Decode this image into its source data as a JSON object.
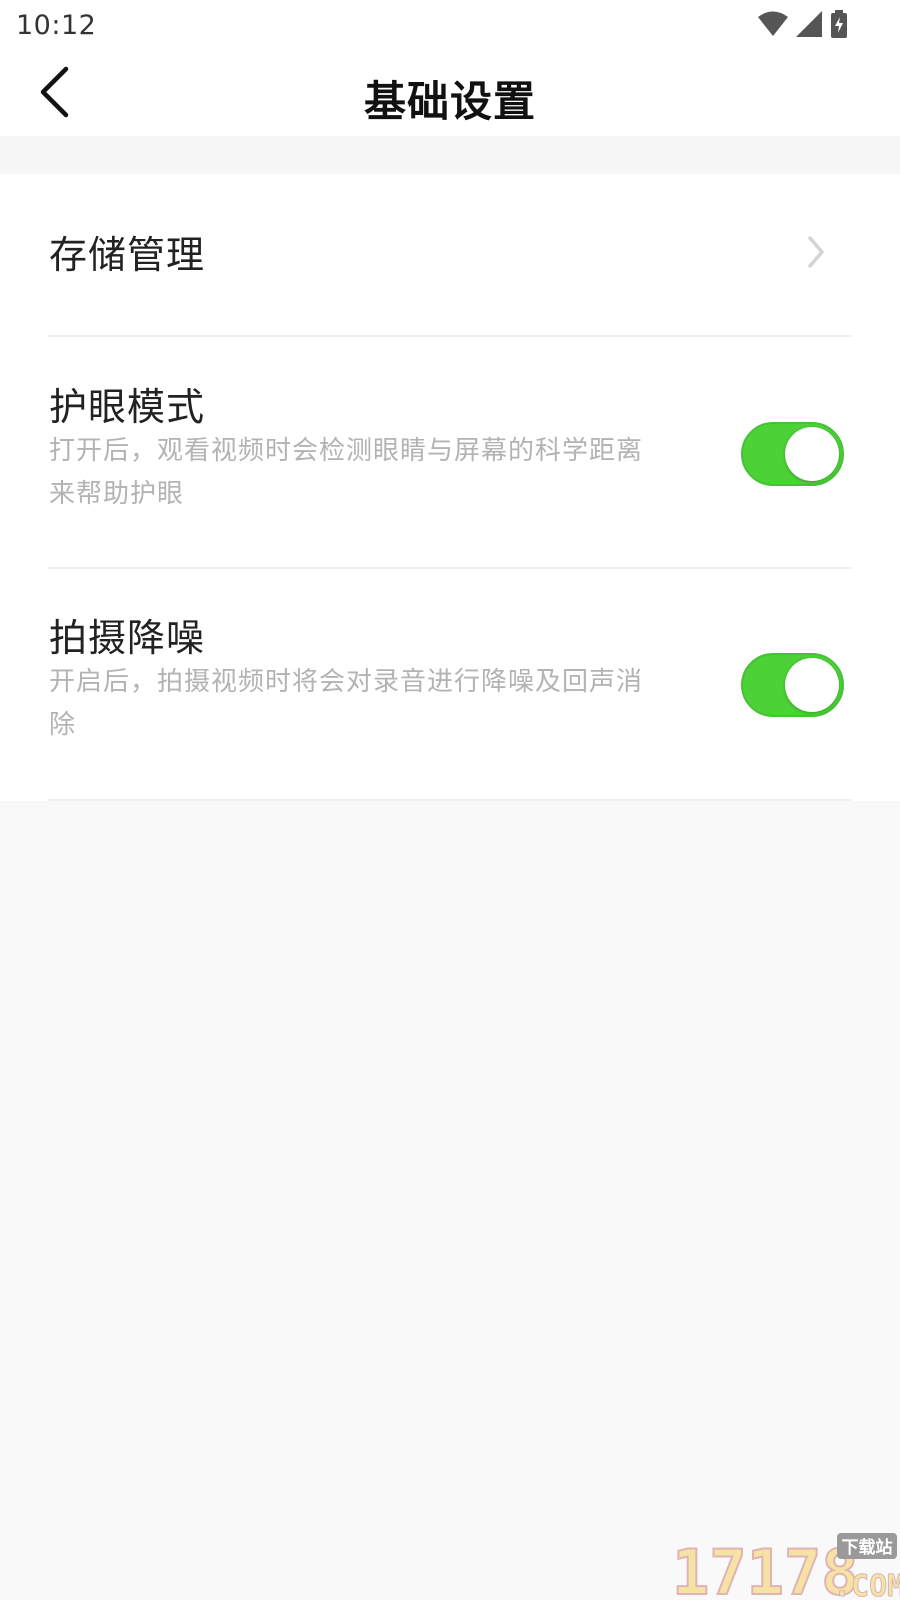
{
  "status_bar": {
    "time": "10:12",
    "icons": [
      "wifi-icon",
      "signal-icon",
      "battery-charging-icon"
    ]
  },
  "nav": {
    "title": "基础设置",
    "back_icon": "chevron-left-icon"
  },
  "settings": {
    "storage": {
      "title": "存储管理",
      "icon": "chevron-right-icon"
    },
    "eye_care": {
      "title": "护眼模式",
      "desc_line1": "打开后，观看视频时会检测眼睛与屏幕的科学距离",
      "desc_line2": "来帮助护眼",
      "enabled": true
    },
    "noise_reduction": {
      "title": "拍摄降噪",
      "desc_line1": "开启后，拍摄视频时将会对录音进行降噪及回声消",
      "desc_line2": "除",
      "enabled": true
    }
  },
  "colors": {
    "toggle_on": "#4cd137",
    "title_text": "#111111",
    "desc_text": "#b3b3b3",
    "background": "#f9f9fa"
  },
  "watermark": {
    "main": "17178",
    "sub": "下载站",
    "domain": ".COM"
  }
}
